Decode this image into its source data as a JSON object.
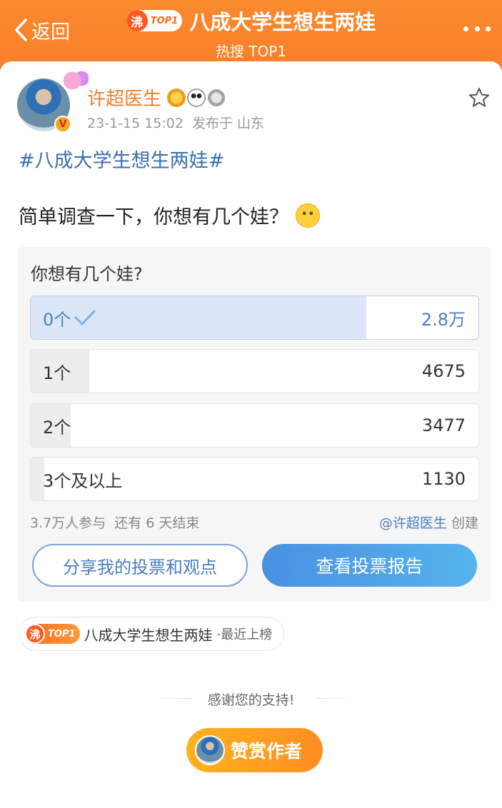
{
  "header": {
    "back_label": "返回",
    "title": "八成大学生想生两娃",
    "subtitle": "热搜 TOP1",
    "badge_boil": "沸",
    "badge_rank": "TOP1"
  },
  "post": {
    "author": "许超医生",
    "verified_mark": "V",
    "time": "23-1-15 15:02",
    "location": "发布于 山东",
    "hashtag": "#八成大学生想生两娃#",
    "text": "简单调查一下，你想有几个娃？"
  },
  "poll": {
    "question": "你想有几个娃?",
    "options": [
      {
        "label": "0个",
        "count": "2.8万",
        "share": 0.75,
        "selected": true
      },
      {
        "label": "1个",
        "count": "4675",
        "share": 0.13,
        "selected": false
      },
      {
        "label": "2个",
        "count": "3477",
        "share": 0.09,
        "selected": false
      },
      {
        "label": "3个及以上",
        "count": "1130",
        "share": 0.03,
        "selected": false
      }
    ],
    "participants": "3.7万人参与",
    "remaining": "还有 6 天结束",
    "creator_name": "@许超医生",
    "creator_suffix": "创建",
    "share_button": "分享我的投票和观点",
    "report_button": "查看投票报告"
  },
  "hot_tag": {
    "badge_boil": "沸",
    "badge_rank": "TOP1",
    "title": "八成大学生想生两娃",
    "suffix": "·最近上榜"
  },
  "footer": {
    "thanks": "感谢您的支持!",
    "reward_button": "赞赏作者"
  },
  "colors": {
    "header_orange": "#fb7e2a",
    "link_blue": "#3a6fb0",
    "author_orange": "#f47d2a",
    "selected_fill": "#dbe7f6"
  }
}
